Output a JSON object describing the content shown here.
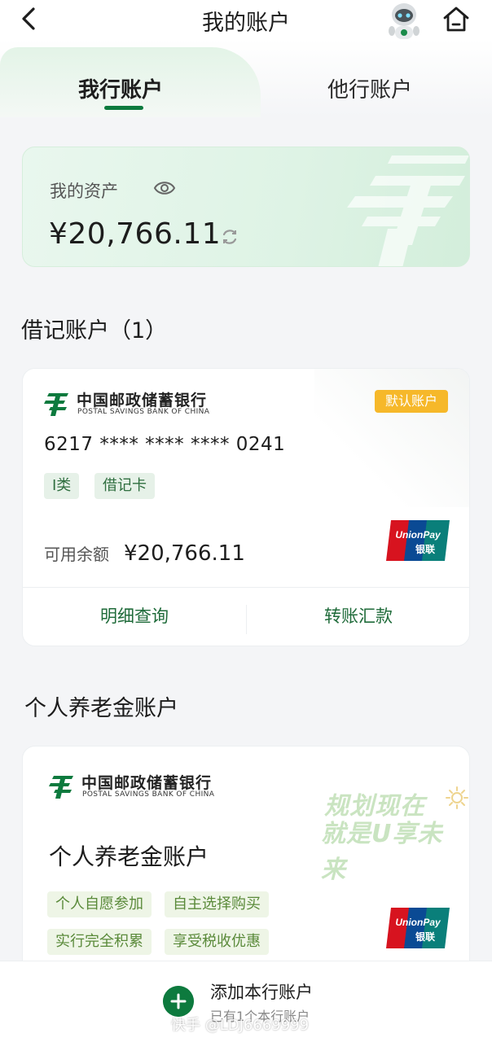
{
  "header": {
    "title": "我的账户",
    "back_icon": "chevron-left-icon",
    "robot_icon": "assistant-robot-icon",
    "home_icon": "home-icon"
  },
  "tabs": [
    {
      "label": "我行账户",
      "active": true
    },
    {
      "label": "他行账户",
      "active": false
    }
  ],
  "assets": {
    "label": "我的资产",
    "amount": "¥20,766.11",
    "eye_icon": "eye-icon",
    "refresh_icon": "refresh-icon"
  },
  "debit_section": {
    "title": "借记账户（1）"
  },
  "debit_card": {
    "bank_cn": "中国邮政储蓄银行",
    "bank_en": "POSTAL SAVINGS BANK OF CHINA",
    "badge": "默认账户",
    "card_number": "6217 **** **** **** 0241",
    "tags": [
      "I类",
      "借记卡"
    ],
    "balance_label": "可用余额",
    "balance_value": "¥20,766.11",
    "unionpay_en": "UnionPay",
    "unionpay_cn": "银联",
    "actions": [
      "明细查询",
      "转账汇款"
    ]
  },
  "pension_section": {
    "title": "个人养老金账户"
  },
  "pension_card": {
    "bank_cn": "中国邮政储蓄银行",
    "bank_en": "POSTAL SAVINGS BANK OF CHINA",
    "title": "个人养老金账户",
    "slogan_line1": "规划现在",
    "slogan_line2": "就是U享未来",
    "tags": [
      "个人自愿参加",
      "自主选择购买",
      "实行完全积累",
      "享受税收优惠"
    ],
    "unionpay_en": "UnionPay",
    "unionpay_cn": "银联"
  },
  "bottom": {
    "add_label": "添加本行账户",
    "add_sub": "已有1个本行账户",
    "watermark": "快手 @LDJ6669999"
  },
  "colors": {
    "brand_green": "#0d7a3e",
    "badge_yellow": "#f6b82a",
    "unionpay_red": "#d7131f",
    "unionpay_blue": "#0a4a94",
    "unionpay_teal": "#0a7f7a"
  }
}
